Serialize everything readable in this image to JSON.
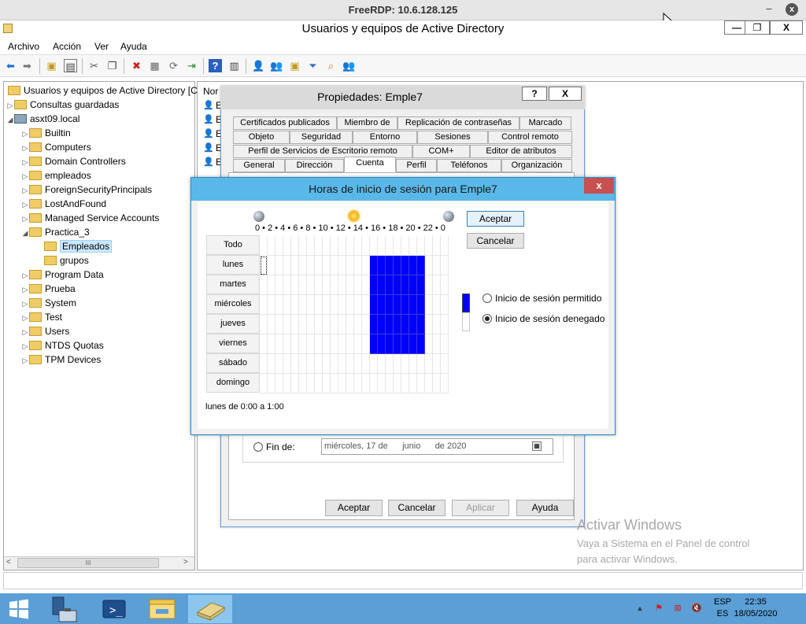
{
  "rdp": {
    "title": "FreeRDP: 10.6.128.125",
    "minimize": "–",
    "close": "x"
  },
  "app": {
    "title": "Usuarios y equipos de Active Directory",
    "caption": {
      "minimize": "—",
      "restore": "❐",
      "close": "X"
    }
  },
  "menu": [
    "Archivo",
    "Acción",
    "Ver",
    "Ayuda"
  ],
  "tree": {
    "root": "Usuarios y equipos de Active Directory [C",
    "items": [
      {
        "label": "Consultas guardadas",
        "level": 1,
        "expander": "▷"
      },
      {
        "label": "asxt09.local",
        "level": 1,
        "expander": "◢",
        "icon": "domain"
      },
      {
        "label": "Builtin",
        "level": 2,
        "expander": "▷"
      },
      {
        "label": "Computers",
        "level": 2,
        "expander": "▷"
      },
      {
        "label": "Domain Controllers",
        "level": 2,
        "expander": "▷"
      },
      {
        "label": "empleados",
        "level": 2,
        "expander": "▷"
      },
      {
        "label": "ForeignSecurityPrincipals",
        "level": 2,
        "expander": "▷"
      },
      {
        "label": "LostAndFound",
        "level": 2,
        "expander": "▷"
      },
      {
        "label": "Managed Service Accounts",
        "level": 2,
        "expander": "▷"
      },
      {
        "label": "Practica_3",
        "level": 2,
        "expander": "◢"
      },
      {
        "label": "Empleados",
        "level": 3,
        "expander": "",
        "selected": true
      },
      {
        "label": "grupos",
        "level": 3,
        "expander": ""
      },
      {
        "label": "Program Data",
        "level": 2,
        "expander": "▷"
      },
      {
        "label": "Prueba",
        "level": 2,
        "expander": "▷"
      },
      {
        "label": "System",
        "level": 2,
        "expander": "▷"
      },
      {
        "label": "Test",
        "level": 2,
        "expander": "▷"
      },
      {
        "label": "Users",
        "level": 2,
        "expander": "▷"
      },
      {
        "label": "NTDS Quotas",
        "level": 2,
        "expander": "▷"
      },
      {
        "label": "TPM Devices",
        "level": 2,
        "expander": "▷"
      }
    ],
    "hscroll": {
      "left": "<",
      "thumb": "III",
      "right": ">"
    }
  },
  "list": {
    "header": "Nor",
    "rows": [
      "E",
      "E",
      "E",
      "E",
      "E"
    ]
  },
  "props": {
    "title": "Propiedades: Emple7",
    "help": "?",
    "close": "X",
    "tabs_row1": [
      "Certificados publicados",
      "Miembro de",
      "Replicación de contraseñas",
      "Marcado"
    ],
    "tabs_row2": [
      "Objeto",
      "Seguridad",
      "Entorno",
      "Sesiones",
      "Control remoto"
    ],
    "tabs_row3": [
      "Perfil de Servicios de Escritorio remoto",
      "COM+",
      "Editor de atributos"
    ],
    "tabs_row4": [
      "General",
      "Dirección",
      "Cuenta",
      "Perfil",
      "Teléfonos",
      "Organización"
    ],
    "selected_tab": "Cuenta",
    "fin_label": "Fin de:",
    "fin_date": {
      "weekday": "miércoles,",
      "day": "17",
      "de1": "de",
      "month": "junio",
      "de2": "de",
      "year": "2020"
    },
    "buttons": {
      "ok": "Aceptar",
      "cancel": "Cancelar",
      "apply": "Aplicar",
      "help": "Ayuda"
    }
  },
  "hours": {
    "title": "Horas de inicio de sesión para Emple7",
    "close": "x",
    "header": "0 • 2 • 4 • 6 • 8 • 10 • 12 • 14 • 16 • 18 • 20 • 22 • 0",
    "all_label": "Todo",
    "days": [
      "lunes",
      "martes",
      "miércoles",
      "jueves",
      "viernes",
      "sábado",
      "domingo"
    ],
    "permitted_hours": {
      "start": 14,
      "end": 21,
      "days": [
        "lunes",
        "martes",
        "miércoles",
        "jueves",
        "viernes"
      ]
    },
    "selected_cell": {
      "day": "lunes",
      "hour": 0
    },
    "status": "lunes de 0:00 a 1:00",
    "ok": "Aceptar",
    "cancel": "Cancelar",
    "radio_permitted": "Inicio de sesión permitido",
    "radio_denied": "Inicio de sesión denegado",
    "selected_radio": "denied",
    "colors": {
      "permitted": "#0000ff",
      "denied": "#ffffff"
    }
  },
  "watermark": {
    "title": "Activar Windows",
    "line1": "Vaya a Sistema en el Panel de control",
    "line2": "para activar Windows."
  },
  "taskbar": {
    "lang1": "ESP",
    "lang2": "ES",
    "time": "22:35",
    "date": "18/05/2020"
  }
}
